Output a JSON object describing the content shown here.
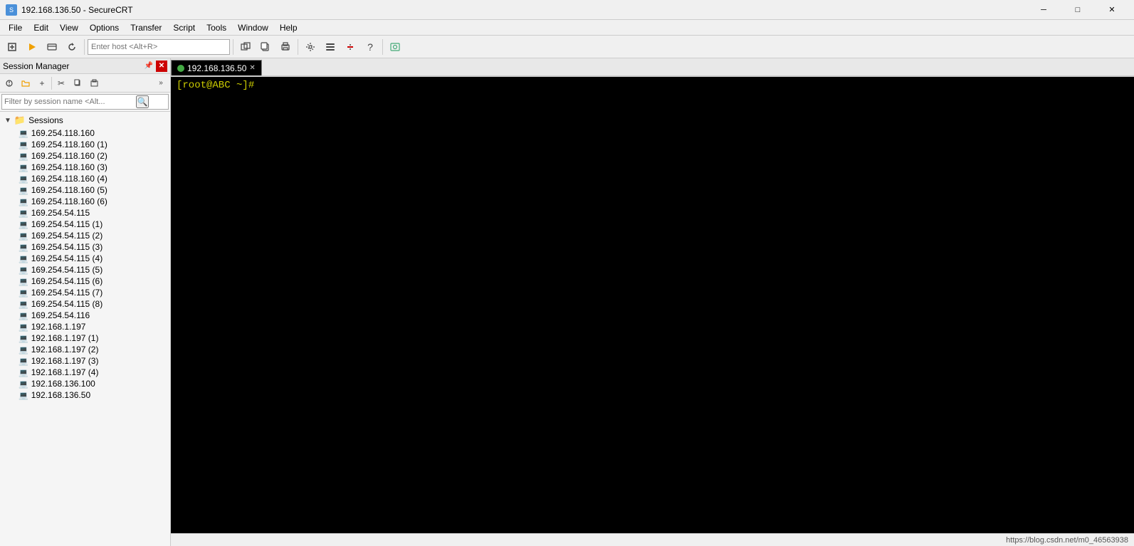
{
  "window": {
    "title": "192.168.136.50 - SecureCRT",
    "icon": "S"
  },
  "menubar": {
    "items": [
      "File",
      "Edit",
      "View",
      "Options",
      "Transfer",
      "Script",
      "Tools",
      "Window",
      "Help"
    ]
  },
  "toolbar": {
    "host_placeholder": "Enter host <Alt+R>",
    "buttons": [
      "new",
      "lightning",
      "connect-bar",
      "reconnect",
      "divider",
      "clone",
      "clone2",
      "print-bar",
      "divider2",
      "settings",
      "sessions-bar",
      "disconnect",
      "help",
      "divider3",
      "screenshot"
    ]
  },
  "session_panel": {
    "title": "Session Manager",
    "pin_label": "📌",
    "close_label": "✕",
    "toolbar_buttons": [
      "link",
      "folder",
      "add",
      "cut",
      "copy",
      "paste"
    ],
    "filter_placeholder": "Filter by session name <Alt...",
    "tree": {
      "root_label": "Sessions",
      "sessions": [
        "169.254.118.160",
        "169.254.118.160 (1)",
        "169.254.118.160 (2)",
        "169.254.118.160 (3)",
        "169.254.118.160 (4)",
        "169.254.118.160 (5)",
        "169.254.118.160 (6)",
        "169.254.54.115",
        "169.254.54.115 (1)",
        "169.254.54.115 (2)",
        "169.254.54.115 (3)",
        "169.254.54.115 (4)",
        "169.254.54.115 (5)",
        "169.254.54.115 (6)",
        "169.254.54.115 (7)",
        "169.254.54.115 (8)",
        "169.254.54.116",
        "192.168.1.197",
        "192.168.1.197 (1)",
        "192.168.1.197 (2)",
        "192.168.1.197 (3)",
        "192.168.1.197 (4)",
        "192.168.136.100",
        "192.168.136.50"
      ]
    }
  },
  "tabs": [
    {
      "label": "192.168.136.50",
      "active": true,
      "has_indicator": true
    }
  ],
  "terminal": {
    "prompt": "[root@ABC ~]#",
    "cursor": " "
  },
  "statusbar": {
    "url": "https://blog.csdn.net/m0_46563938"
  }
}
